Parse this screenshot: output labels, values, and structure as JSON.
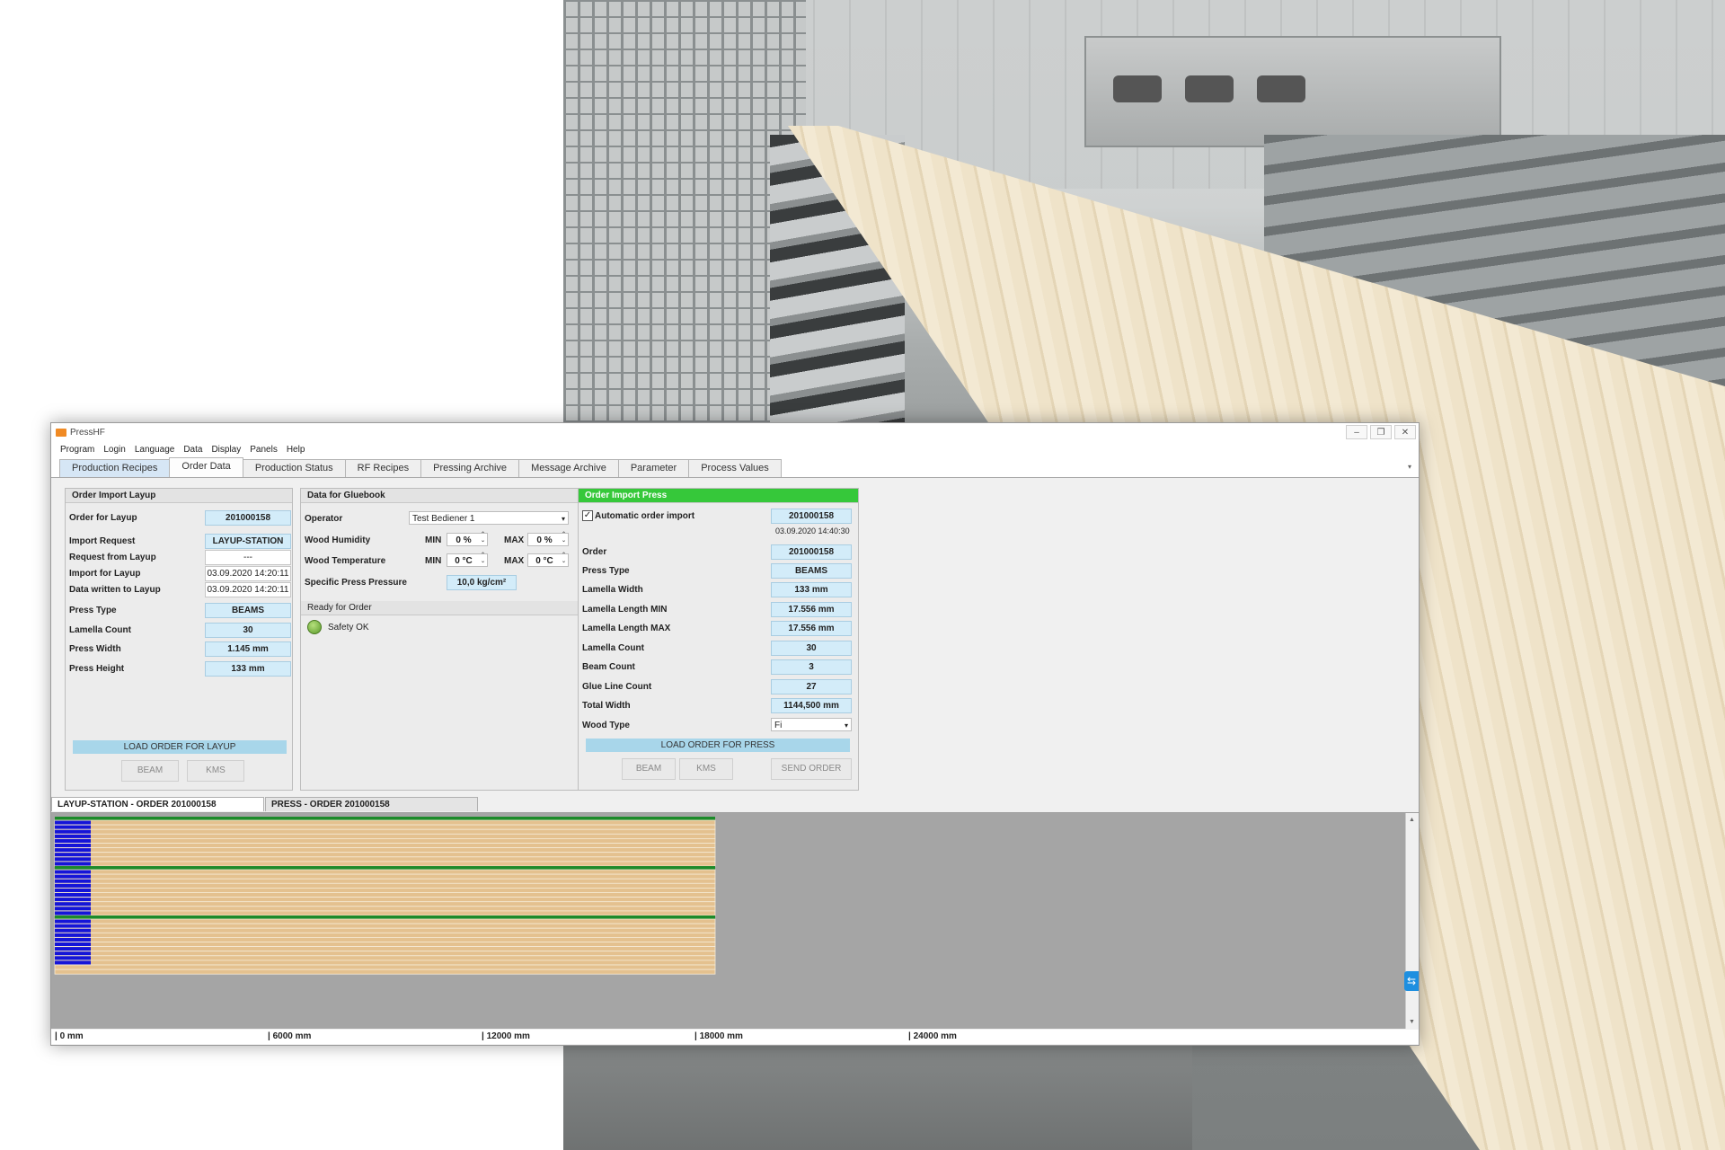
{
  "window": {
    "title": "PressHF",
    "controls": [
      "–",
      "❐",
      "✕"
    ]
  },
  "menu": [
    "Program",
    "Login",
    "Language",
    "Data",
    "Display",
    "Panels",
    "Help"
  ],
  "tabs": [
    {
      "label": "Production Recipes"
    },
    {
      "label": "Order Data"
    },
    {
      "label": "Production Status"
    },
    {
      "label": "RF Recipes"
    },
    {
      "label": "Pressing Archive"
    },
    {
      "label": "Message Archive"
    },
    {
      "label": "Parameter"
    },
    {
      "label": "Process Values"
    }
  ],
  "layup": {
    "title": "Order Import Layup",
    "order_label": "Order for Layup",
    "order_value": "201000158",
    "import_request_label": "Import Request",
    "import_request_value": "LAYUP-STATION",
    "request_from_label": "Request from Layup",
    "request_from_value": "---",
    "import_for_label": "Import for Layup",
    "import_for_value": "03.09.2020 14:20:11",
    "written_label": "Data written to Layup",
    "written_value": "03.09.2020 14:20:11",
    "press_type_label": "Press Type",
    "press_type_value": "BEAMS",
    "lamella_count_label": "Lamella Count",
    "lamella_count_value": "30",
    "press_width_label": "Press Width",
    "press_width_value": "1.145 mm",
    "press_height_label": "Press Height",
    "press_height_value": "133 mm",
    "load_button": "LOAD ORDER FOR LAYUP",
    "beam_button": "BEAM",
    "kms_button": "KMS"
  },
  "gluebook": {
    "title": "Data for Gluebook",
    "operator_label": "Operator",
    "operator_value": "Test Bediener 1",
    "humidity_label": "Wood Humidity",
    "temperature_label": "Wood Temperature",
    "min_label": "MIN",
    "max_label": "MAX",
    "humidity_min": "0 %",
    "humidity_max": "0 %",
    "temp_min": "0 °C",
    "temp_max": "0 °C",
    "pressure_label": "Specific Press Pressure",
    "pressure_value": "10,0 kg/cm²",
    "ready_title": "Ready for Order",
    "safety_label": "Safety OK"
  },
  "press": {
    "title": "Order Import Press",
    "auto_import_label": "Automatic order import",
    "auto_import_order": "201000158",
    "auto_import_time": "03.09.2020 14:40:30",
    "order_label": "Order",
    "order_value": "201000158",
    "press_type_label": "Press Type",
    "press_type_value": "BEAMS",
    "lamella_width_label": "Lamella Width",
    "lamella_width_value": "133 mm",
    "length_min_label": "Lamella Length MIN",
    "length_min_value": "17.556 mm",
    "length_max_label": "Lamella Length MAX",
    "length_max_value": "17.556 mm",
    "lamella_count_label": "Lamella Count",
    "lamella_count_value": "30",
    "beam_count_label": "Beam Count",
    "beam_count_value": "3",
    "glue_line_label": "Glue Line Count",
    "glue_line_value": "27",
    "total_width_label": "Total Width",
    "total_width_value": "1144,500 mm",
    "wood_type_label": "Wood Type",
    "wood_type_value": "Fi",
    "load_button": "LOAD ORDER FOR PRESS",
    "beam_button": "BEAM",
    "kms_button": "KMS",
    "send_button": "SEND ORDER"
  },
  "bottom_tabs": [
    "LAYUP-STATION - ORDER 201000158",
    "PRESS - ORDER 201000158"
  ],
  "visualization": {
    "beams": 3,
    "lamellas_per_beam": 10,
    "length_fraction_of_ruler": 0.4545,
    "colors": {
      "lamella": "#e4c18f",
      "lamella_line": "#f6ead5",
      "separator": "#1c8a2a",
      "marker": "#1414d8",
      "background": "#a5a5a5"
    }
  },
  "ruler": [
    "| 0 mm",
    "| 6000 mm",
    "| 12000 mm",
    "| 18000 mm",
    "| 24000 mm"
  ]
}
